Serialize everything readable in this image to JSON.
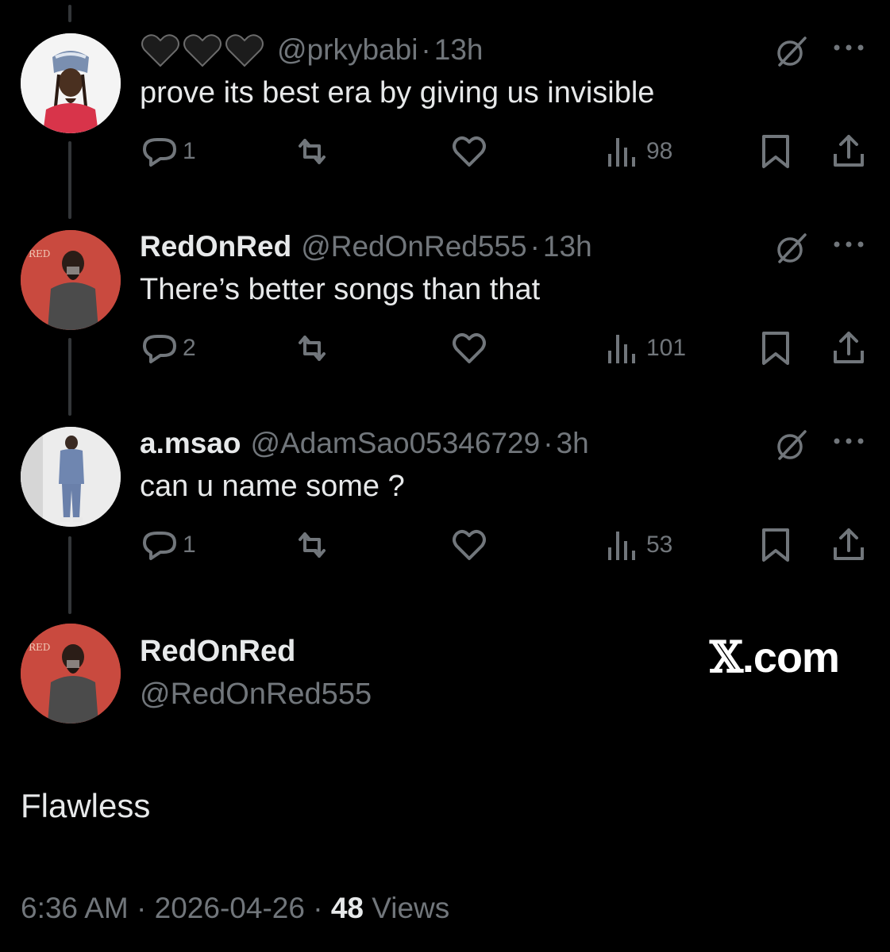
{
  "replies": [
    {
      "name_hearts": [
        "black-heart",
        "black-heart",
        "black-heart"
      ],
      "display_name": "",
      "handle": "@prkybabi",
      "separator": "·",
      "time": "13h",
      "text": "prove its best era by giving us invisible",
      "reply_count": "1",
      "views": "98"
    },
    {
      "display_name": "RedOnRed",
      "handle": "@RedOnRed555",
      "separator": "·",
      "time": "13h",
      "text": "There’s better songs than that",
      "reply_count": "2",
      "views": "101"
    },
    {
      "display_name": "a.msao",
      "handle": "@AdamSao05346729",
      "separator": "·",
      "time": "3h",
      "text": "can u name some ?",
      "reply_count": "1",
      "views": "53"
    }
  ],
  "main_tweet": {
    "display_name": "RedOnRed",
    "handle": "@RedOnRed555",
    "text": "Flawless",
    "time": "6:36 AM",
    "date": "2026-04-26",
    "separator": "·",
    "views_count": "48",
    "views_label": "Views"
  },
  "brand": {
    "x_glyph": "𝕏",
    "domain": ".com"
  },
  "colors": {
    "background": "#000000",
    "text_primary": "#e7e9ea",
    "text_secondary": "#71767b",
    "thread_line": "#333639"
  },
  "icons": [
    "grok-icon",
    "more-icon",
    "reply-icon",
    "retweet-icon",
    "like-icon",
    "views-icon",
    "bookmark-icon",
    "share-icon"
  ]
}
